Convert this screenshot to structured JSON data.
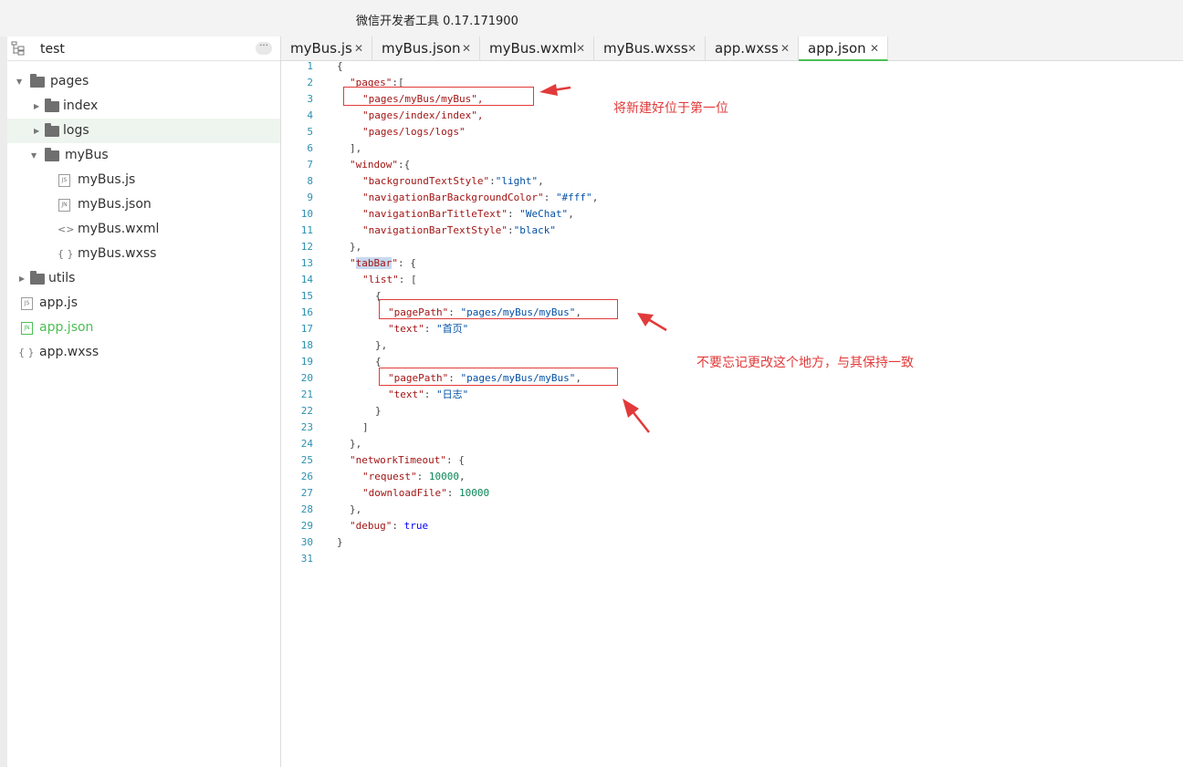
{
  "window": {
    "title": "微信开发者工具 0.17.171900"
  },
  "project": {
    "name": "test",
    "more_label": "···"
  },
  "tree": [
    {
      "label": "pages",
      "type": "folder",
      "expanded": true
    },
    {
      "label": "index",
      "type": "folder",
      "expanded": false
    },
    {
      "label": "logs",
      "type": "folder",
      "expanded": false,
      "selected": true
    },
    {
      "label": "myBus",
      "type": "folder",
      "expanded": true
    },
    {
      "label": "myBus.js",
      "type": "file",
      "icon": "JS"
    },
    {
      "label": "myBus.json",
      "type": "file",
      "icon": "JN"
    },
    {
      "label": "myBus.wxml",
      "type": "file",
      "icon": "<>"
    },
    {
      "label": "myBus.wxss",
      "type": "file",
      "icon": "{ }"
    },
    {
      "label": "utils",
      "type": "folder",
      "expanded": false
    },
    {
      "label": "app.js",
      "type": "file",
      "icon": "JS"
    },
    {
      "label": "app.json",
      "type": "file",
      "icon": "JN",
      "active": true
    },
    {
      "label": "app.wxss",
      "type": "file",
      "icon": "{ }"
    }
  ],
  "tabs": [
    {
      "label": "myBus.js",
      "close": "✕"
    },
    {
      "label": "myBus.json",
      "close": "✕"
    },
    {
      "label": "myBus.wxml",
      "close": "✕"
    },
    {
      "label": "myBus.wxss",
      "close": "✕"
    },
    {
      "label": "app.wxss",
      "close": "✕"
    },
    {
      "label": "app.json",
      "close": "✕",
      "active": true
    }
  ],
  "code_lines": [
    "1",
    "2",
    "3",
    "4",
    "5",
    "6",
    "7",
    "8",
    "9",
    "10",
    "11",
    "12",
    "13",
    "14",
    "15",
    "16",
    "17",
    "18",
    "19",
    "20",
    "21",
    "22",
    "23",
    "24",
    "25",
    "26",
    "27",
    "28",
    "29",
    "30",
    "31"
  ],
  "code": {
    "l1": "{",
    "l2_key": "\"pages\"",
    "l2_rest": ":[",
    "l3": "\"pages/myBus/myBus\",",
    "l4": "\"pages/index/index\",",
    "l5": "\"pages/logs/logs\"",
    "l6": "],",
    "l7_key": "\"window\"",
    "l7_rest": ":{",
    "l8_key": "\"backgroundTextStyle\"",
    "l8_sep": ":",
    "l8_val": "\"light\"",
    "l8_end": ",",
    "l9_key": "\"navigationBarBackgroundColor\"",
    "l9_sep": ": ",
    "l9_val": "\"#fff\"",
    "l9_end": ",",
    "l10_key": "\"navigationBarTitleText\"",
    "l10_sep": ": ",
    "l10_val": "\"WeChat\"",
    "l10_end": ",",
    "l11_key": "\"navigationBarTextStyle\"",
    "l11_sep": ":",
    "l11_val": "\"black\"",
    "l12": "},",
    "l13_q1": "\"",
    "l13_word": "tabBar",
    "l13_q2": "\"",
    "l13_rest": ": {",
    "l14_key": "\"list\"",
    "l14_rest": ": [",
    "l15": "{",
    "l16_key": "\"pagePath\"",
    "l16_sep": ": ",
    "l16_val": "\"pages/myBus/myBus\"",
    "l16_end": ",",
    "l17_key": "\"text\"",
    "l17_sep": ": ",
    "l17_val": "\"首页\"",
    "l18": "},",
    "l19": "{",
    "l20_key": "\"pagePath\"",
    "l20_sep": ": ",
    "l20_val": "\"pages/myBus/myBus\"",
    "l20_end": ",",
    "l21_key": "\"text\"",
    "l21_sep": ": ",
    "l21_val": "\"日志\"",
    "l22": "}",
    "l23": "]",
    "l24": "},",
    "l25_key": "\"networkTimeout\"",
    "l25_rest": ": {",
    "l26_key": "\"request\"",
    "l26_sep": ": ",
    "l26_val": "10000",
    "l26_end": ",",
    "l27_key": "\"downloadFile\"",
    "l27_sep": ": ",
    "l27_val": "10000",
    "l28": "},",
    "l29_key": "\"debug\"",
    "l29_sep": ": ",
    "l29_val": "true",
    "l30": "}"
  },
  "annotations": {
    "note1": "将新建好位于第一位",
    "note2": "不要忘记更改这个地方，与其保持一致",
    "color": "#e23a3a"
  }
}
